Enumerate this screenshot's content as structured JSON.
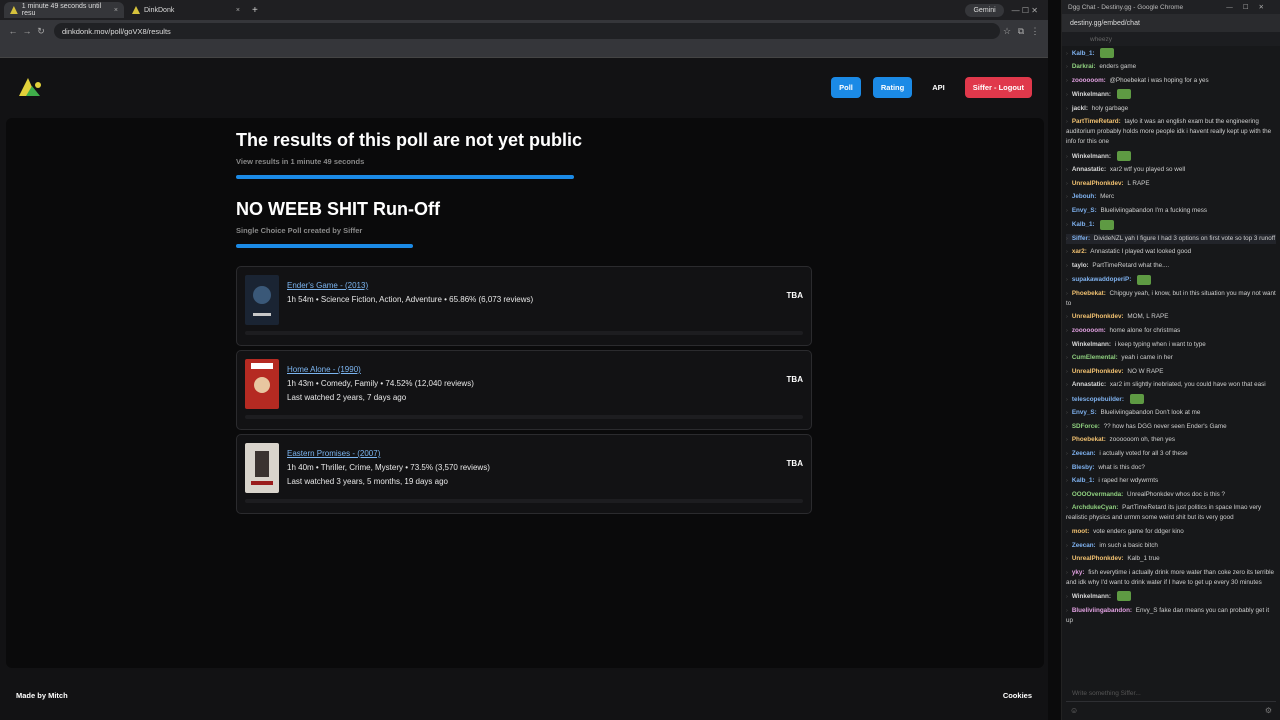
{
  "browser": {
    "tabs": [
      {
        "label": "1 minute 49 seconds until resu",
        "active": true
      },
      {
        "label": "DinkDonk",
        "active": false
      }
    ],
    "gemini_label": "Gemini",
    "url": "dinkdonk.mov/poll/goVX8/results"
  },
  "site": {
    "nav": {
      "poll": "Poll",
      "rating": "Rating",
      "api": "API",
      "logout": "Siffer - Logout"
    },
    "results_heading": "The results of this poll are not yet public",
    "countdown_text": "View results in 1 minute 49 seconds",
    "poll_title": "NO WEEB SHIT Run-Off",
    "poll_subtitle": "Single Choice Poll created by Siffer",
    "movies": [
      {
        "title": "Ender's Game - (2013)",
        "info": "1h 54m • Science Fiction, Action, Adventure • 65.86% (6,073 reviews)",
        "last_watched": "",
        "result": "TBA"
      },
      {
        "title": "Home Alone - (1990)",
        "info": "1h 43m • Comedy, Family • 74.52% (12,040 reviews)",
        "last_watched": "Last watched 2 years, 7 days ago",
        "result": "TBA"
      },
      {
        "title": "Eastern Promises - (2007)",
        "info": "1h 40m • Thriller, Crime, Mystery • 73.5% (3,570 reviews)",
        "last_watched": "Last watched 3 years, 5 months, 19 days ago",
        "result": "TBA"
      }
    ],
    "footer": {
      "made_by": "Made by Mitch",
      "cookies": "Cookies"
    }
  },
  "chat": {
    "window_title": "Dgg Chat - Destiny.gg - Google Chrome",
    "url": "destiny.gg/embed/chat",
    "top_user": "wheezy",
    "messages": [
      {
        "user": "Kalb_1",
        "text": ""
      },
      {
        "user": "Darkrai",
        "text": "enders game"
      },
      {
        "user": "zoooooom",
        "text": "@Phoebekat i was hoping for a yes"
      },
      {
        "user": "Winkelmann",
        "text": ""
      },
      {
        "user": "jackl",
        "text": "holy garbage"
      },
      {
        "user": "PartTimeRetard",
        "text": "taylo it was an english exam but the engineering auditorium probably holds more people  idk i havent really kept up with the info for this one"
      },
      {
        "user": "Winkelmann",
        "text": ""
      },
      {
        "user": "Annastatic",
        "text": "xar2 wtf you played so well"
      },
      {
        "user": "UnrealPhonkdev",
        "text": "L RAPE"
      },
      {
        "user": "Jebouh",
        "text": "Merc"
      },
      {
        "user": "Envy_S",
        "text": "Blueliviingabandon I'm a fucking mess"
      },
      {
        "user": "Kalb_1",
        "text": ""
      },
      {
        "user": "Siffer",
        "text": "DivideNZL yah I figure I had 3 options on first vote so top 3 runoff"
      },
      {
        "user": "xar2",
        "text": "Annastatic  I played wat looked good"
      },
      {
        "user": "taylo",
        "text": "PartTimeRetard what the...."
      },
      {
        "user": "supakawaddoperiP",
        "text": ""
      },
      {
        "user": "Phoebekat",
        "text": "Chipguy yeah, i know, but in this situation you may not want to"
      },
      {
        "user": "UnrealPhonkdev",
        "text": "MOM, L RAPE"
      },
      {
        "user": "zoooooom",
        "text": "home alone for christmas"
      },
      {
        "user": "Winkelmann",
        "text": "i keep typing  when i want to type"
      },
      {
        "user": "CumElemental",
        "text": "yeah i came in her"
      },
      {
        "user": "UnrealPhonkdev",
        "text": "NO W RAPE"
      },
      {
        "user": "Annastatic",
        "text": "xar2 im slightly inebriated, you could have won that easi"
      },
      {
        "user": "telescopebuilder",
        "text": ""
      },
      {
        "user": "Envy_S",
        "text": "Blueliviingabandon Don't look at me"
      },
      {
        "user": "SDForce",
        "text": "?? how has DGG never seen Ender's Game"
      },
      {
        "user": "Phoebekat",
        "text": "zoooooom oh, then yes"
      },
      {
        "user": "Zeecan",
        "text": "i actually voted for all 3 of these"
      },
      {
        "user": "Blesby",
        "text": "what is this doc?"
      },
      {
        "user": "Kalb_1",
        "text": "i raped her wdywrmts"
      },
      {
        "user": "OOOOvermanda",
        "text": "UnrealPhonkdev whos doc is this ?"
      },
      {
        "user": "ArchdukeCyan",
        "text": "PartTimeRetard its just politics in space lmao very realistic physics and urmm some weird shit but its very good"
      },
      {
        "user": "moot",
        "text": "vote enders game for ddger kino"
      },
      {
        "user": "Zeecan",
        "text": "im such a basic bitch"
      },
      {
        "user": "UnrealPhonkdev",
        "text": "Kalb_1  true"
      },
      {
        "user": "yky",
        "text": "fish everytime i actually drink more water than coke zero its terrible and idk why I'd want to drink water if I have to get up every 30 minutes"
      },
      {
        "user": "Winkelmann",
        "text": ""
      },
      {
        "user": "Blueliviingabandon",
        "text": "Envy_S fake dan means you can probably get it up"
      }
    ],
    "input_placeholder": "Write something Siffer..."
  }
}
